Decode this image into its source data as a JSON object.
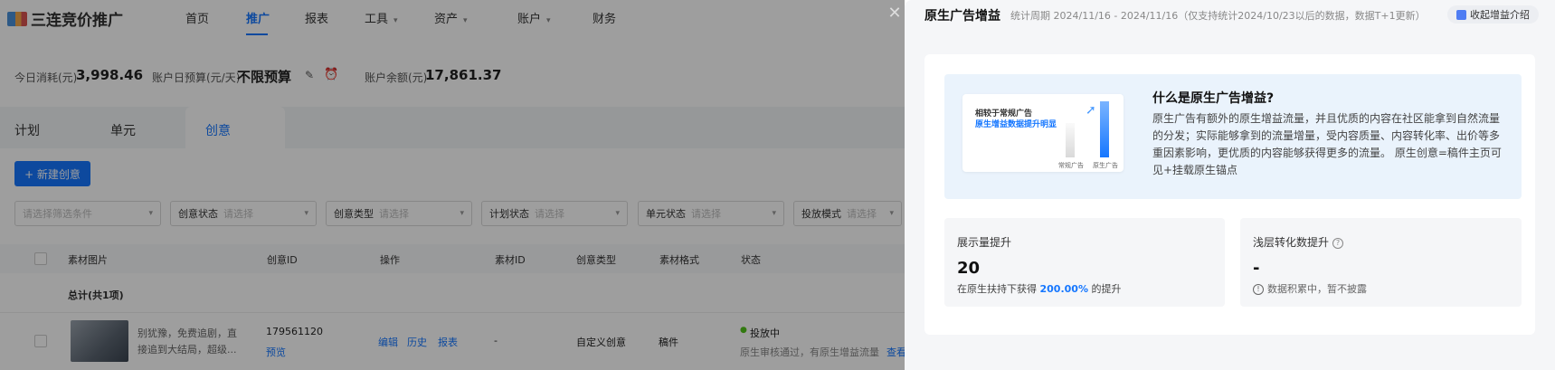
{
  "app": {
    "logo_text": "三连竞价推广"
  },
  "nav": [
    {
      "label": "首页",
      "active": false,
      "caret": false
    },
    {
      "label": "推广",
      "active": true,
      "caret": false
    },
    {
      "label": "报表",
      "active": false,
      "caret": false
    },
    {
      "label": "工具",
      "active": false,
      "caret": true
    },
    {
      "label": "资产",
      "active": false,
      "caret": true
    },
    {
      "label": "账户",
      "active": false,
      "caret": true
    },
    {
      "label": "财务",
      "active": false,
      "caret": false
    }
  ],
  "budget": {
    "today_label": "今日消耗(元)",
    "today_value": "3,998.46",
    "daily_label": "账户日预算(元/天)",
    "daily_value": "不限预算",
    "balance_label": "账户余额(元)",
    "balance_value": "17,861.37"
  },
  "tabs": [
    {
      "label": "计划"
    },
    {
      "label": "单元"
    },
    {
      "label": "创意"
    }
  ],
  "new_button": "+ 新建创意",
  "filters": [
    {
      "label": "",
      "placeholder": "请选择筛选条件"
    },
    {
      "label": "创意状态",
      "placeholder": "请选择"
    },
    {
      "label": "创意类型",
      "placeholder": "请选择"
    },
    {
      "label": "计划状态",
      "placeholder": "请选择"
    },
    {
      "label": "单元状态",
      "placeholder": "请选择"
    },
    {
      "label": "投放模式",
      "placeholder": "请选择"
    }
  ],
  "table": {
    "headers": [
      "素材图片",
      "创意ID",
      "操作",
      "素材ID",
      "创意类型",
      "素材格式",
      "状态"
    ],
    "total_label": "总计(共1项)",
    "row": {
      "desc_line1": "别犹豫，免费追剧，直",
      "desc_line2": "接追到大结局，超级...",
      "creative_id": "179561120",
      "preview": "预览",
      "actions": [
        "编辑",
        "历史",
        "报表"
      ],
      "material_id": "-",
      "creative_type": "自定义创意",
      "format": "稿件",
      "status": "投放中",
      "status_note": "原生审核通过，有原生增益流量",
      "status_link": "查看"
    }
  },
  "close_icon": "close-icon",
  "panel": {
    "title": "原生广告增益",
    "period": "统计周期 2024/11/16 - 2024/11/16（仅支持统计2024/10/23以后的数据，数据T+1更新）",
    "collapse_label": "收起增益介绍",
    "illustration": {
      "line1": "相较于常规广告",
      "line2": "原生增益数据提升明显",
      "bar_label_a": "常规广告",
      "bar_label_b": "原生广告"
    },
    "intro_heading": "什么是原生广告增益?",
    "intro_body": "原生广告有额外的原生增益流量，并且优质的内容在社区能拿到自然流量的分发；实际能够拿到的流量增量，受内容质量、内容转化率、出价等多重因素影响，更优质的内容能够获得更多的流量。 原生创意=稿件主页可见+挂载原生锚点",
    "stats": [
      {
        "label": "展示量提升",
        "value": "20",
        "desc_prefix": "在原生扶持下获得 ",
        "desc_highlight": "200.00%",
        "desc_suffix": " 的提升"
      },
      {
        "label": "浅层转化数提升",
        "value": "-",
        "desc_prefix": "数据积累中，暂不披露",
        "desc_highlight": "",
        "desc_suffix": ""
      }
    ]
  },
  "colors": {
    "accent": "#1677ff",
    "overlay": "rgba(0,0,0,0.38)",
    "status_green": "#52c41a"
  }
}
